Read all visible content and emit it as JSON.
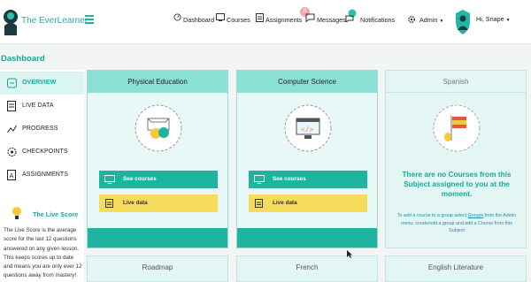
{
  "app": {
    "brand": "The EverLearner"
  },
  "nav": {
    "dashboard": "Dashboard",
    "courses": "Courses",
    "assignments": "Assignments",
    "assignments_badge": "0",
    "messages": "Messages",
    "notifications": "Notifications",
    "admin": "Admin",
    "user": "Hi, Snape"
  },
  "page": {
    "title": "Dashboard"
  },
  "sidebar": {
    "items": [
      {
        "label": "OVERVIEW",
        "icon": "overview-icon"
      },
      {
        "label": "LIVE DATA",
        "icon": "live-data-icon"
      },
      {
        "label": "PROGRESS",
        "icon": "progress-icon"
      },
      {
        "label": "CHECKPOINTS",
        "icon": "checkpoints-icon"
      },
      {
        "label": "ASSIGNMENTS",
        "icon": "assignments-icon"
      }
    ],
    "live_score_title": "The Live Score",
    "live_score_text": "The Live Score is the average score for the last 12 questions answered on any given lesson. This keeps scores up to date and means you are only ever 12 questions away from mastery!"
  },
  "cards": [
    {
      "title": "Physical Education",
      "see_courses": "See courses",
      "live_data": "Live data"
    },
    {
      "title": "Computer Science",
      "see_courses": "See courses",
      "live_data": "Live data"
    },
    {
      "title": "Spanish",
      "empty_title": "There are no Courses from this Subject assigned to you at the moment.",
      "empty_text_1": "To add a course to a group select ",
      "empty_link": "Groups",
      "empty_text_2": " from the Admin menu; create/edit a group and add a Course from this Subject"
    }
  ],
  "more_cards": [
    "Roadmap",
    "French",
    "English Literature"
  ],
  "colors": {
    "accent": "#20b39f",
    "header": "#8be0d6",
    "yellow": "#f6dc5d",
    "title": "#1ba597"
  }
}
